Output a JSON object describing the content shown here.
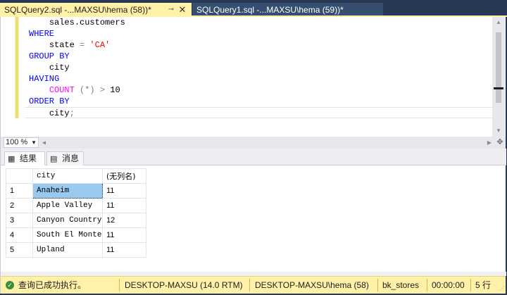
{
  "tabs": [
    {
      "title": "SQLQuery2.sql -...MAXSU\\hema (58))*",
      "pin": "⊸",
      "close": "✕",
      "active": true
    },
    {
      "title": "SQLQuery1.sql -...MAXSU\\hema (59))*",
      "active": false
    }
  ],
  "editor": {
    "lines": [
      {
        "indent": "    ",
        "parts": [
          {
            "t": "sales.customers",
            "c": ""
          }
        ]
      },
      {
        "indent": "",
        "parts": [
          {
            "t": "WHERE",
            "c": "kw"
          }
        ]
      },
      {
        "indent": "    ",
        "parts": [
          {
            "t": "state ",
            "c": ""
          },
          {
            "t": "=",
            "c": "op"
          },
          {
            "t": " 'CA'",
            "c": "str"
          }
        ]
      },
      {
        "indent": "",
        "parts": [
          {
            "t": "GROUP BY",
            "c": "kw"
          }
        ]
      },
      {
        "indent": "    ",
        "parts": [
          {
            "t": "city",
            "c": ""
          }
        ]
      },
      {
        "indent": "",
        "parts": [
          {
            "t": "HAVING",
            "c": "kw"
          }
        ]
      },
      {
        "indent": "    ",
        "parts": [
          {
            "t": "COUNT",
            "c": "fn"
          },
          {
            "t": " (*)",
            "c": "op"
          },
          {
            "t": " ",
            "c": ""
          },
          {
            "t": ">",
            "c": "op"
          },
          {
            "t": " 10",
            "c": ""
          }
        ]
      },
      {
        "indent": "",
        "parts": [
          {
            "t": "ORDER BY",
            "c": "kw"
          }
        ]
      },
      {
        "indent": "    ",
        "parts": [
          {
            "t": "city",
            "c": ""
          },
          {
            "t": ";",
            "c": "op"
          }
        ]
      }
    ]
  },
  "zoom": {
    "value": "100 %"
  },
  "results_tabs": {
    "results": "结果",
    "messages": "消息"
  },
  "grid": {
    "columns": [
      "city",
      "(无列名)"
    ],
    "rows": [
      {
        "n": "1",
        "city": "Anaheim",
        "count": "11"
      },
      {
        "n": "2",
        "city": "Apple Valley",
        "count": "11"
      },
      {
        "n": "3",
        "city": "Canyon Country",
        "count": "12"
      },
      {
        "n": "4",
        "city": "South El Monte",
        "count": "11"
      },
      {
        "n": "5",
        "city": "Upland",
        "count": "11"
      }
    ]
  },
  "status": {
    "message": "查询已成功执行。",
    "server": "DESKTOP-MAXSU (14.0 RTM)",
    "user": "DESKTOP-MAXSU\\hema (58)",
    "database": "bk_stores",
    "elapsed": "00:00:00",
    "rows": "5 行"
  },
  "colors": {
    "accent": "#fff1a8",
    "chrome": "#293955",
    "keyword": "#0000ff",
    "function": "#ff00ff",
    "string": "#ff0000"
  }
}
